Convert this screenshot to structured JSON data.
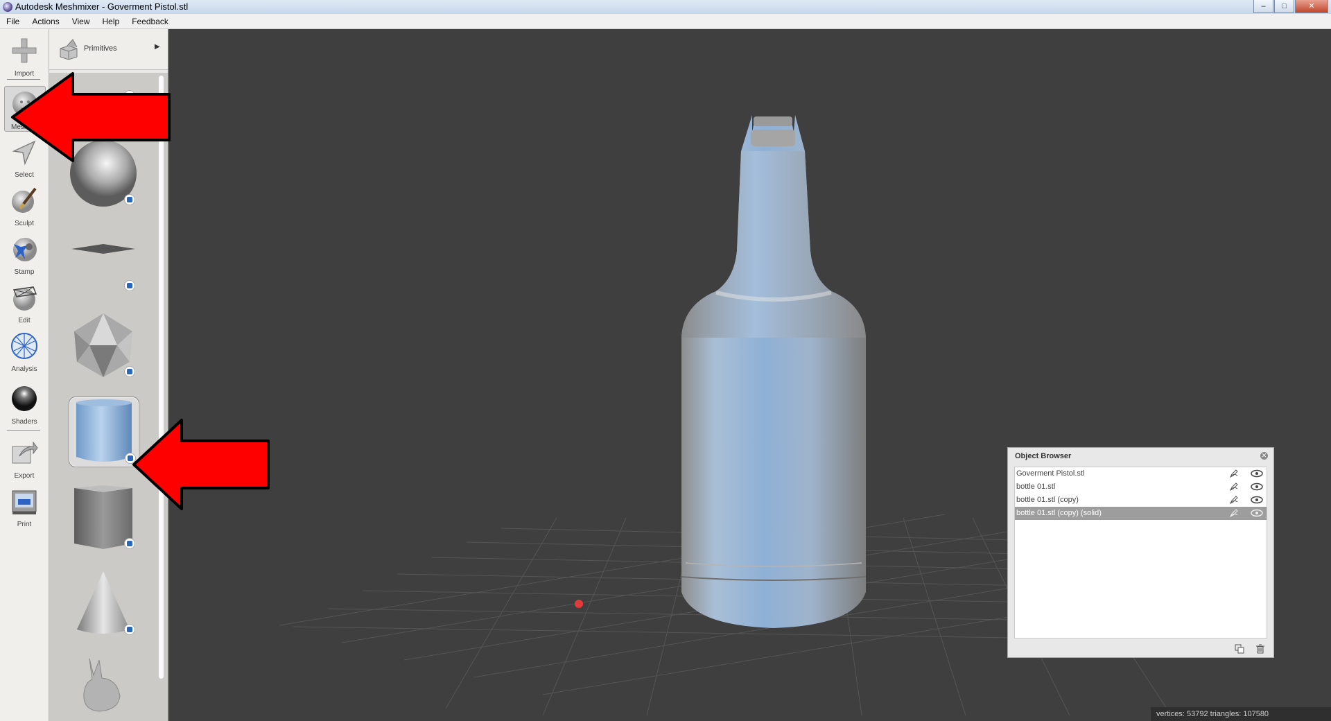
{
  "window": {
    "title": "Autodesk Meshmixer - Goverment Pistol.stl",
    "controls": [
      "–",
      "□",
      "✕"
    ]
  },
  "menu": [
    "File",
    "Actions",
    "View",
    "Help",
    "Feedback"
  ],
  "tools": [
    {
      "label": "Import",
      "icon": "plus-icon"
    },
    {
      "label": "Meshmix",
      "icon": "meshmix-head-icon",
      "active": true
    },
    {
      "label": "Select",
      "icon": "select-arrow-icon"
    },
    {
      "label": "Sculpt",
      "icon": "sculpt-brush-icon"
    },
    {
      "label": "Stamp",
      "icon": "stamp-icon"
    },
    {
      "label": "Edit",
      "icon": "edit-icon"
    },
    {
      "label": "Analysis",
      "icon": "analysis-icon"
    },
    {
      "label": "Shaders",
      "icon": "shader-ball-icon"
    },
    {
      "label": "Export",
      "icon": "export-icon"
    },
    {
      "label": "Print",
      "icon": "printer-icon"
    }
  ],
  "palette": {
    "category": "Primitives",
    "items": [
      "sphere",
      "plane",
      "icosahedron",
      "cylinder",
      "cube",
      "cone",
      "bunny"
    ],
    "selected": "cylinder"
  },
  "object_browser": {
    "title": "Object Browser",
    "items": [
      {
        "name": "Goverment Pistol.stl",
        "selected": false
      },
      {
        "name": "bottle 01.stl",
        "selected": false
      },
      {
        "name": "bottle 01.stl (copy)",
        "selected": false
      },
      {
        "name": "bottle 01.stl (copy) (solid)",
        "selected": true
      }
    ]
  },
  "status": {
    "text": "vertices: 53792 triangles: 107580"
  },
  "colors": {
    "viewport_bg": "#3f3f3f",
    "annotation_arrow": "#ff0000",
    "selection_highlight": "#9d9d9d"
  }
}
